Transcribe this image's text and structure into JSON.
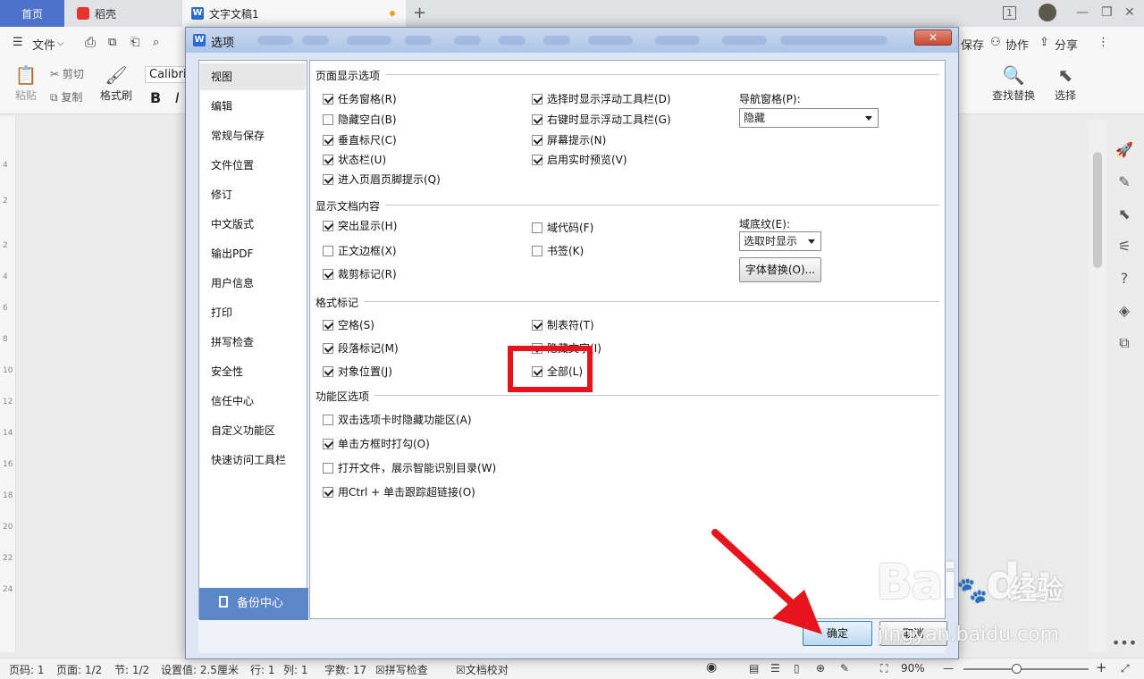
{
  "tabs": {
    "home": "首页",
    "daoke": "稻壳",
    "doc": "文字文稿1",
    "add": "+"
  },
  "titlebar_right": {
    "page_indicator": "1",
    "minimize": "—",
    "restore": "❐",
    "close": "✕"
  },
  "menubar": {
    "file": "文件",
    "save": "保存",
    "collaborate": "协作",
    "share": "分享",
    "more": "⋮"
  },
  "toolbar": {
    "paste": "粘贴",
    "cut": "剪切",
    "copy": "复制",
    "format_painter": "格式刷",
    "font": "Calibri",
    "bold": "B",
    "italic": "I",
    "find_replace": "查找替换",
    "select": "选择"
  },
  "ruler_numbers": [
    "4",
    "2",
    "2",
    "4",
    "6",
    "8",
    "10",
    "12",
    "14",
    "16",
    "18",
    "20",
    "22",
    "24"
  ],
  "dialog": {
    "title": "选项",
    "close": "✕",
    "nav": [
      "视图",
      "编辑",
      "常规与保存",
      "文件位置",
      "修订",
      "中文版式",
      "输出PDF",
      "用户信息",
      "打印",
      "拼写检查",
      "安全性",
      "信任中心",
      "自定义功能区",
      "快速访问工具栏"
    ],
    "nav_selected": 0,
    "backup": "备份中心",
    "sections": {
      "page_display": "页面显示选项",
      "doc_content": "显示文档内容",
      "format_marks": "格式标记",
      "ribbon": "功能区选项"
    },
    "page_display": {
      "col1": [
        {
          "label": "任务窗格(R)",
          "checked": true
        },
        {
          "label": "隐藏空白(B)",
          "checked": false
        },
        {
          "label": "垂直标尺(C)",
          "checked": true
        },
        {
          "label": "状态栏(U)",
          "checked": true
        },
        {
          "label": "进入页眉页脚提示(Q)",
          "checked": true
        }
      ],
      "col2": [
        {
          "label": "选择时显示浮动工具栏(D)",
          "checked": true
        },
        {
          "label": "右键时显示浮动工具栏(G)",
          "checked": true
        },
        {
          "label": "屏幕提示(N)",
          "checked": true
        },
        {
          "label": "启用实时预览(V)",
          "checked": true
        }
      ],
      "nav_pane_label": "导航窗格(P):",
      "nav_pane_value": "隐藏"
    },
    "doc_content": {
      "col1": [
        {
          "label": "突出显示(H)",
          "checked": true
        },
        {
          "label": "正文边框(X)",
          "checked": false
        },
        {
          "label": "裁剪标记(R)",
          "checked": true
        }
      ],
      "col2": [
        {
          "label": "域代码(F)",
          "checked": false
        },
        {
          "label": "书签(K)",
          "checked": false
        }
      ],
      "field_shading_label": "域底纹(E):",
      "field_shading_value": "选取时显示",
      "font_sub_button": "字体替换(O)..."
    },
    "format_marks": {
      "col1": [
        {
          "label": "空格(S)",
          "checked": true
        },
        {
          "label": "段落标记(M)",
          "checked": true
        },
        {
          "label": "对象位置(J)",
          "checked": true
        }
      ],
      "col2": [
        {
          "label": "制表符(T)",
          "checked": true
        },
        {
          "label": "隐藏文字(I)",
          "checked": true
        },
        {
          "label": "全部(L)",
          "checked": true
        }
      ]
    },
    "ribbon": [
      {
        "label": "双击选项卡时隐藏功能区(A)",
        "checked": false
      },
      {
        "label": "单击方框时打勾(O)",
        "checked": true
      },
      {
        "label": "打开文件，展示智能识别目录(W)",
        "checked": false
      },
      {
        "label": "用Ctrl + 单击跟踪超链接(O)",
        "checked": true
      }
    ],
    "ok": "确定",
    "cancel": "取消"
  },
  "statusbar": {
    "page_num": "页码: 1",
    "pages": "页面: 1/2",
    "section": "节: 1/2",
    "setting": "设置值: 2.5厘米",
    "row": "行: 1",
    "col": "列: 1",
    "words": "字数: 17",
    "spell": "拼写检查",
    "proof": "文档校对",
    "zoom": "90%"
  },
  "watermark": {
    "brand": "Bai",
    "brand2": "du",
    "cn": "经验",
    "url": "jingyan.baidu.com"
  },
  "colors": {
    "accent_tab": "#4d72c9",
    "highlight": "#e8141b",
    "backup": "#5b86c8"
  }
}
